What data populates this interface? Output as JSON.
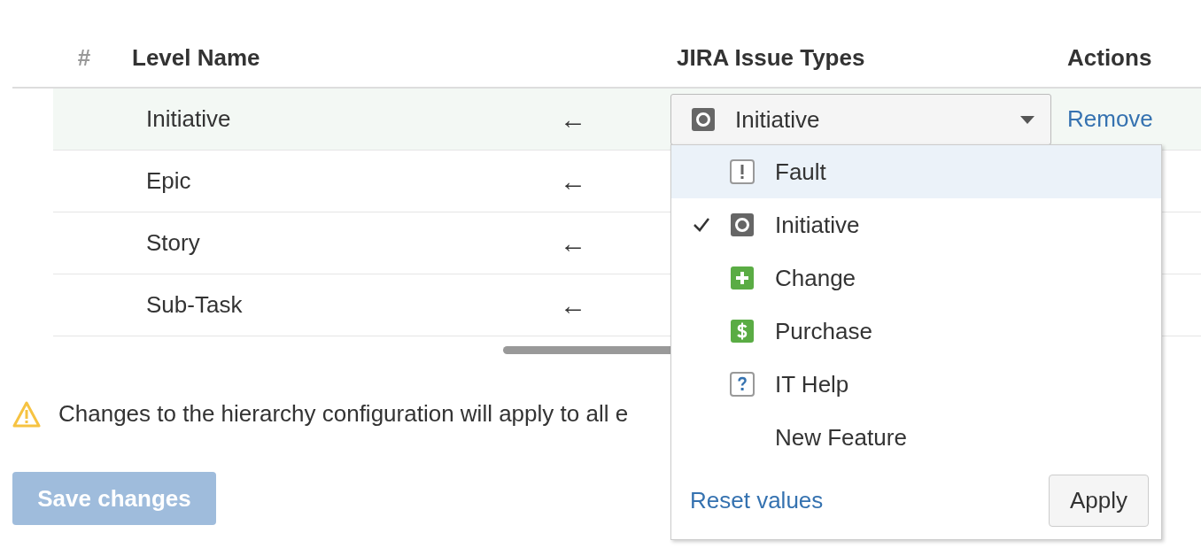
{
  "table": {
    "columns": [
      "#",
      "Level Name",
      "JIRA Issue Types",
      "Actions"
    ],
    "rows": [
      {
        "name": "Initiative",
        "arrow": "←",
        "selected": true,
        "issue_type": "Initiative",
        "action": "Remove"
      },
      {
        "name": "Epic",
        "arrow": "←",
        "selected": false
      },
      {
        "name": "Story",
        "arrow": "←",
        "selected": false
      },
      {
        "name": "Sub-Task",
        "arrow": "←",
        "selected": false
      }
    ]
  },
  "dropdown": {
    "items": [
      {
        "label": "Fault",
        "kind": "fault",
        "checked": false,
        "highlighted": true
      },
      {
        "label": "Initiative",
        "kind": "initiative",
        "checked": true,
        "highlighted": false
      },
      {
        "label": "Change",
        "kind": "change",
        "checked": false,
        "highlighted": false
      },
      {
        "label": "Purchase",
        "kind": "purchase",
        "checked": false,
        "highlighted": false
      },
      {
        "label": "IT Help",
        "kind": "help",
        "checked": false,
        "highlighted": false
      },
      {
        "label": "New Feature",
        "kind": "plain",
        "checked": false,
        "highlighted": false
      }
    ],
    "reset": "Reset values",
    "apply": "Apply"
  },
  "warning": "Changes to the hierarchy configuration will apply to all e",
  "save_button": {
    "label": "Save changes",
    "disabled": true
  }
}
